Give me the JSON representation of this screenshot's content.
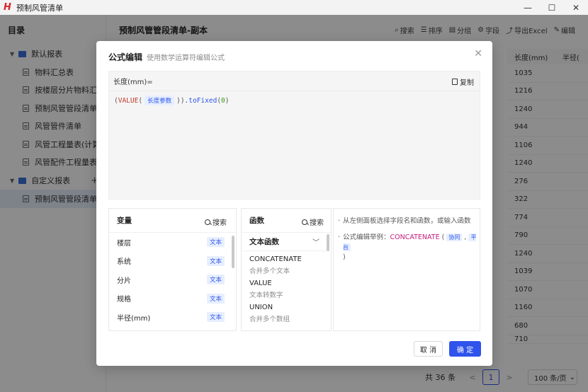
{
  "window": {
    "title": "预制风管清单",
    "controls": {
      "minimize": "—",
      "maximize": "☐",
      "close": "✕"
    }
  },
  "sidebar": {
    "heading": "目录",
    "groups": [
      {
        "label": "默认报表",
        "items": [
          "物料汇总表",
          "按楼层分片物料汇总",
          "预制风管管段清单",
          "风管管件清单",
          "风管工程量表(计算…",
          "风管配件工程量表"
        ]
      },
      {
        "label": "自定义报表",
        "add": "+",
        "items": [
          "预制风管管段清单-…"
        ]
      }
    ]
  },
  "main": {
    "title": "预制风管管段清单-副本",
    "toolbar": [
      "搜索",
      "排序",
      "分组",
      "字段",
      "导出Excel",
      "编辑"
    ],
    "column_headers": [
      "长度(mm)",
      "半径("
    ],
    "length_values": [
      "1035",
      "1216",
      "1240",
      "944",
      "1106",
      "1240",
      "276",
      "322",
      "774",
      "790",
      "1240",
      "1039",
      "1070",
      "1160",
      "680",
      "710"
    ],
    "pager": {
      "total": "共 36 条",
      "prev": "<",
      "page": "1",
      "next": ">",
      "page_size": "100 条/页"
    }
  },
  "modal": {
    "title": "公式编辑",
    "subtitle": "使用数学运算符编辑公式",
    "close": "✕",
    "editor": {
      "field_label": "长度(mm)=",
      "copy_label": "复制",
      "formula": {
        "open": "(",
        "fn": "VALUE",
        "paren_open": "(",
        "var": "长度参数",
        "close": "))",
        "method": ".toFixed",
        "arg_open": "(",
        "arg": "0",
        "arg_close": ")"
      }
    },
    "variables": {
      "heading": "变量",
      "search": "搜索",
      "items": [
        {
          "name": "楼层",
          "type": "文本"
        },
        {
          "name": "系统",
          "type": "文本"
        },
        {
          "name": "分片",
          "type": "文本"
        },
        {
          "name": "规格",
          "type": "文本"
        },
        {
          "name": "半径(mm)",
          "type": "文本"
        }
      ]
    },
    "functions": {
      "heading": "函数",
      "search": "搜索",
      "category": "文本函数",
      "items": [
        {
          "name": "CONCATENATE",
          "desc": "合并多个文本"
        },
        {
          "name": "VALUE",
          "desc": "文本转数字"
        },
        {
          "name": "UNION",
          "desc": "合并多个数组"
        }
      ]
    },
    "help": {
      "line1": "从左侧面板选择字段名和函数，或输入函数",
      "line2_prefix": "公式编辑举例：",
      "line2_fn": "CONCATENATE",
      "line2_open": "(",
      "line2_arg1": "协同",
      "line2_sep": ",",
      "line2_arg2": "平台",
      "line2_close": ")"
    },
    "buttons": {
      "cancel": "取 消",
      "ok": "确 定"
    }
  }
}
